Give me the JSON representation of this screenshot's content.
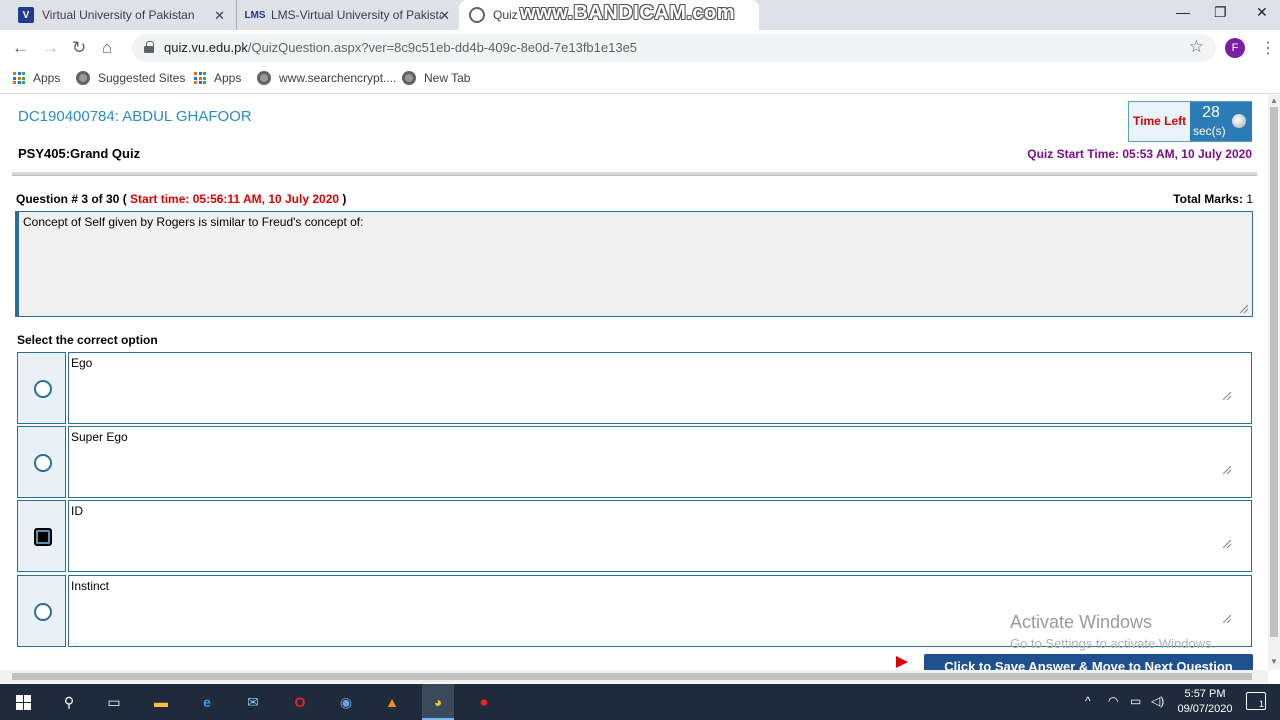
{
  "browser": {
    "tabs": [
      {
        "title": "Virtual University of Pakistan",
        "icon": "vu-favicon"
      },
      {
        "title": "LMS-Virtual University of Pakistan",
        "icon": "lms-favicon"
      },
      {
        "title": "Quiz",
        "icon": "globe-favicon",
        "active": true
      }
    ],
    "watermark": "www.BANDICAM.com",
    "url_host": "quiz.vu.edu.pk",
    "url_path": "/QuizQuestion.aspx?ver=8c9c51eb-dd4b-409c-8e0d-7e13fb1e13e5",
    "profile_initial": "F",
    "bookmarks": [
      {
        "label": "Apps",
        "icon": "apps-grid-icon"
      },
      {
        "label": "Suggested Sites",
        "icon": "globe-icon"
      },
      {
        "label": "Apps",
        "icon": "apps-grid-icon"
      },
      {
        "label": "www.searchencrypt....",
        "icon": "globe-icon"
      },
      {
        "label": "New Tab",
        "icon": "globe-icon"
      }
    ]
  },
  "quiz": {
    "student": "DC190400784: ABDUL GHAFOOR",
    "course": "PSY405:Grand Quiz",
    "time_left_label": "Time Left",
    "time_left_value": "28",
    "time_left_unit": "sec(s)",
    "quiz_start": "Quiz Start Time: 05:53 AM, 10 July 2020",
    "question_label": "Question # 3 of 30 (",
    "question_start": "Start time: 05:56:11 AM, 10 July 2020",
    "question_close": ")",
    "total_marks_label": "Total Marks:",
    "total_marks_value": "1",
    "question_text": "Concept of Self given by Rogers is similar to Freud's concept of:",
    "select_label": "Select the correct option",
    "options": [
      {
        "text": "Ego",
        "selected": false
      },
      {
        "text": "Super Ego",
        "selected": false
      },
      {
        "text": "ID",
        "selected": true
      },
      {
        "text": "Instinct",
        "selected": false
      }
    ],
    "submit_label": "Click to Save Answer & Move to Next Question"
  },
  "overlay": {
    "activate_title": "Activate Windows",
    "activate_sub": "Go to Settings to activate Windows."
  },
  "taskbar": {
    "time": "5:57 PM",
    "date": "09/07/2020",
    "notifications": "1"
  },
  "colors": {
    "accent_blue": "#2a6f97",
    "student_blue": "#2a8bc5",
    "time_red": "#e00000",
    "start_purple": "#7b0d8a",
    "submit_blue": "#1e4f8e"
  }
}
